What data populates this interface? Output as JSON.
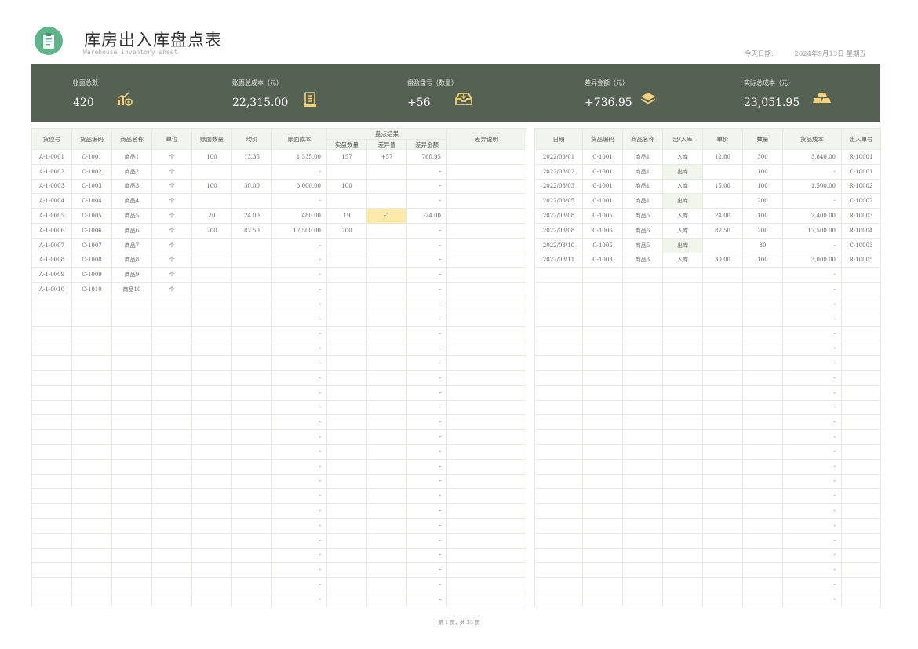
{
  "header": {
    "title": "库房出入库盘点表",
    "subtitle": "Warehouse inventory sheet",
    "date_label": "今天日期:",
    "date_value": "2024年9月13日 星期五"
  },
  "stats": [
    {
      "label": "帐面总数",
      "value": "420",
      "icon": "chart-coins-icon"
    },
    {
      "label": "账面总成本（元）",
      "value": "22,315.00",
      "icon": "receipt-icon"
    },
    {
      "label": "盘盈盘亏（数量）",
      "value": "+56",
      "icon": "inbox-tray-icon"
    },
    {
      "label": "差异金额（元）",
      "value": "+736.95",
      "icon": "layers-icon"
    },
    {
      "label": "实际总成本（元）",
      "value": "23,051.95",
      "icon": "gold-bars-icon"
    }
  ],
  "left_table": {
    "headers": {
      "location": "货位号",
      "code": "货品编码",
      "name": "商品名称",
      "unit": "单位",
      "book_qty": "账面数量",
      "avg_price": "均价",
      "book_cost": "账面成本",
      "result_group": "盘点结果",
      "actual_qty": "实盘数量",
      "diff_qty": "差异值",
      "diff_amount": "差异金额",
      "note": "差异说明"
    },
    "rows": [
      [
        "A-1-0001",
        "C-1001",
        "商品1",
        "个",
        "100",
        "13.35",
        "1,335.00",
        "157",
        "+57",
        "760.95",
        ""
      ],
      [
        "A-1-0002",
        "C-1002",
        "商品2",
        "个",
        "",
        "",
        "-",
        "",
        "",
        "-",
        ""
      ],
      [
        "A-1-0003",
        "C-1003",
        "商品3",
        "个",
        "100",
        "30.00",
        "3,000.00",
        "100",
        "",
        "-",
        ""
      ],
      [
        "A-1-0004",
        "C-1004",
        "商品4",
        "个",
        "",
        "",
        "-",
        "",
        "",
        "-",
        ""
      ],
      [
        "A-1-0005",
        "C-1005",
        "商品5",
        "个",
        "20",
        "24.00",
        "480.00",
        "19",
        "-1",
        "-24.00",
        ""
      ],
      [
        "A-1-0006",
        "C-1006",
        "商品6",
        "个",
        "200",
        "87.50",
        "17,500.00",
        "200",
        "",
        "-",
        ""
      ],
      [
        "A-1-0007",
        "C-1007",
        "商品7",
        "个",
        "",
        "",
        "-",
        "",
        "",
        "-",
        ""
      ],
      [
        "A-1-0008",
        "C-1008",
        "商品8",
        "个",
        "",
        "",
        "-",
        "",
        "",
        "-",
        ""
      ],
      [
        "A-1-0009",
        "C-1009",
        "商品9",
        "个",
        "",
        "",
        "-",
        "",
        "",
        "-",
        ""
      ],
      [
        "A-1-0010",
        "C-1010",
        "商品10",
        "个",
        "",
        "",
        "-",
        "",
        "",
        "-",
        ""
      ],
      [
        "",
        "",
        "",
        "",
        "",
        "",
        "-",
        "",
        "",
        "-",
        ""
      ],
      [
        "",
        "",
        "",
        "",
        "",
        "",
        "-",
        "",
        "",
        "-",
        ""
      ],
      [
        "",
        "",
        "",
        "",
        "",
        "",
        "-",
        "",
        "",
        "-",
        ""
      ],
      [
        "",
        "",
        "",
        "",
        "",
        "",
        "-",
        "",
        "",
        "-",
        ""
      ],
      [
        "",
        "",
        "",
        "",
        "",
        "",
        "-",
        "",
        "",
        "-",
        ""
      ],
      [
        "",
        "",
        "",
        "",
        "",
        "",
        "-",
        "",
        "",
        "-",
        ""
      ],
      [
        "",
        "",
        "",
        "",
        "",
        "",
        "-",
        "",
        "",
        "-",
        ""
      ],
      [
        "",
        "",
        "",
        "",
        "",
        "",
        "-",
        "",
        "",
        "-",
        ""
      ],
      [
        "",
        "",
        "",
        "",
        "",
        "",
        "-",
        "",
        "",
        "-",
        ""
      ],
      [
        "",
        "",
        "",
        "",
        "",
        "",
        "-",
        "",
        "",
        "-",
        ""
      ],
      [
        "",
        "",
        "",
        "",
        "",
        "",
        "-",
        "",
        "",
        "-",
        ""
      ],
      [
        "",
        "",
        "",
        "",
        "",
        "",
        "-",
        "",
        "",
        "-",
        ""
      ],
      [
        "",
        "",
        "",
        "",
        "",
        "",
        "-",
        "",
        "",
        "-",
        ""
      ],
      [
        "",
        "",
        "",
        "",
        "",
        "",
        "-",
        "",
        "",
        "-",
        ""
      ],
      [
        "",
        "",
        "",
        "",
        "",
        "",
        "-",
        "",
        "",
        "-",
        ""
      ],
      [
        "",
        "",
        "",
        "",
        "",
        "",
        "-",
        "",
        "",
        "-",
        ""
      ],
      [
        "",
        "",
        "",
        "",
        "",
        "",
        "-",
        "",
        "",
        "-",
        ""
      ],
      [
        "",
        "",
        "",
        "",
        "",
        "",
        "-",
        "",
        "",
        "-",
        ""
      ],
      [
        "",
        "",
        "",
        "",
        "",
        "",
        "-",
        "",
        "",
        "-",
        ""
      ],
      [
        "",
        "",
        "",
        "",
        "",
        "",
        "-",
        "",
        "",
        "-",
        ""
      ],
      [
        "",
        "",
        "",
        "",
        "",
        "",
        "-",
        "",
        "",
        "-",
        ""
      ]
    ]
  },
  "right_table": {
    "headers": {
      "date": "日期",
      "code": "货品编码",
      "name": "商品名称",
      "direction": "出/入库",
      "unit_price": "单价",
      "qty": "数量",
      "cost": "货品成本",
      "order_no": "出入单号"
    },
    "rows": [
      [
        "2022/03/01",
        "C-1001",
        "商品1",
        "入库",
        "12.80",
        "300",
        "3,840.00",
        "R-10001"
      ],
      [
        "2022/03/02",
        "C-1001",
        "商品1",
        "出库",
        "",
        "100",
        "-",
        "C-10001"
      ],
      [
        "2022/03/03",
        "C-1001",
        "商品1",
        "入库",
        "15.00",
        "100",
        "1,500.00",
        "R-10002"
      ],
      [
        "2022/03/05",
        "C-1001",
        "商品1",
        "出库",
        "",
        "200",
        "-",
        "C-10002"
      ],
      [
        "2022/03/08",
        "C-1005",
        "商品5",
        "入库",
        "24.00",
        "100",
        "2,400.00",
        "R-10003"
      ],
      [
        "2022/03/08",
        "C-1006",
        "商品6",
        "入库",
        "87.50",
        "200",
        "17,500.00",
        "R-10004"
      ],
      [
        "2022/03/10",
        "C-1005",
        "商品5",
        "出库",
        "",
        "80",
        "-",
        "C-10003"
      ],
      [
        "2022/03/11",
        "C-1003",
        "商品3",
        "入库",
        "30.00",
        "100",
        "3,000.00",
        "R-10005"
      ],
      [
        "",
        "",
        "",
        "",
        "",
        "",
        "-",
        ""
      ],
      [
        "",
        "",
        "",
        "",
        "",
        "",
        "-",
        ""
      ],
      [
        "",
        "",
        "",
        "",
        "",
        "",
        "-",
        ""
      ],
      [
        "",
        "",
        "",
        "",
        "",
        "",
        "-",
        ""
      ],
      [
        "",
        "",
        "",
        "",
        "",
        "",
        "-",
        ""
      ],
      [
        "",
        "",
        "",
        "",
        "",
        "",
        "-",
        ""
      ],
      [
        "",
        "",
        "",
        "",
        "",
        "",
        "-",
        ""
      ],
      [
        "",
        "",
        "",
        "",
        "",
        "",
        "-",
        ""
      ],
      [
        "",
        "",
        "",
        "",
        "",
        "",
        "-",
        ""
      ],
      [
        "",
        "",
        "",
        "",
        "",
        "",
        "-",
        ""
      ],
      [
        "",
        "",
        "",
        "",
        "",
        "",
        "-",
        ""
      ],
      [
        "",
        "",
        "",
        "",
        "",
        "",
        "-",
        ""
      ],
      [
        "",
        "",
        "",
        "",
        "",
        "",
        "-",
        ""
      ],
      [
        "",
        "",
        "",
        "",
        "",
        "",
        "-",
        ""
      ],
      [
        "",
        "",
        "",
        "",
        "",
        "",
        "-",
        ""
      ],
      [
        "",
        "",
        "",
        "",
        "",
        "",
        "-",
        ""
      ],
      [
        "",
        "",
        "",
        "",
        "",
        "",
        "-",
        ""
      ],
      [
        "",
        "",
        "",
        "",
        "",
        "",
        "-",
        ""
      ],
      [
        "",
        "",
        "",
        "",
        "",
        "",
        "-",
        ""
      ],
      [
        "",
        "",
        "",
        "",
        "",
        "",
        "-",
        ""
      ],
      [
        "",
        "",
        "",
        "",
        "",
        "",
        "-",
        ""
      ],
      [
        "",
        "",
        "",
        "",
        "",
        "",
        "-",
        ""
      ],
      [
        "",
        "",
        "",
        "",
        "",
        "",
        "-",
        ""
      ]
    ]
  },
  "footer": {
    "page_info": "第 1 页，共 33 页"
  },
  "colors": {
    "banner": "#556152",
    "icon": "#f4d27a",
    "logo": "#5fb58a",
    "highlight": "#fde9a8"
  }
}
